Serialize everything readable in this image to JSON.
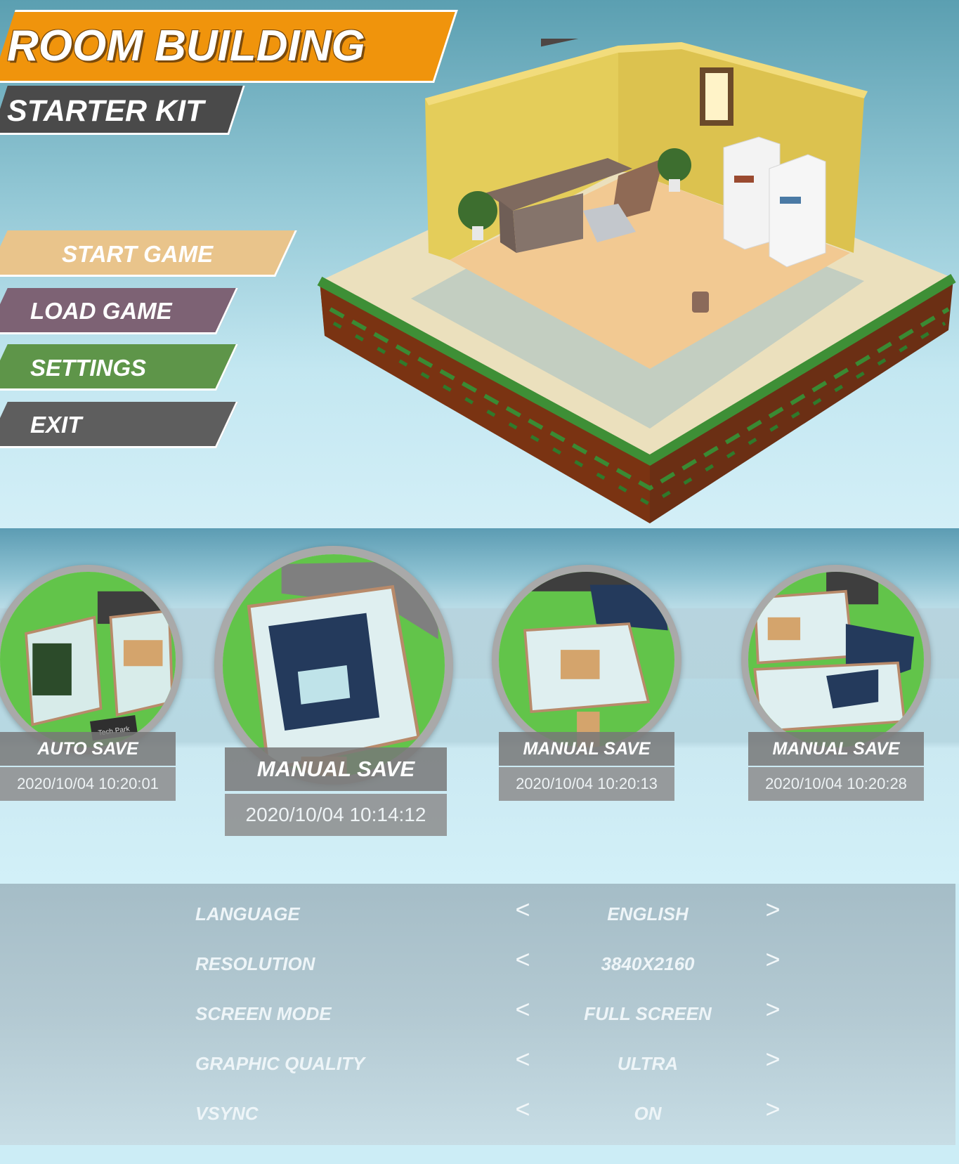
{
  "title": {
    "main": "ROOM BUILDING",
    "sub": "STARTER KIT"
  },
  "menu": [
    {
      "label": "START GAME",
      "color": "#e9c48b"
    },
    {
      "label": "LOAD GAME",
      "color": "#7d6274"
    },
    {
      "label": "SETTINGS",
      "color": "#5e9549"
    },
    {
      "label": "EXIT",
      "color": "#5e5e5e"
    }
  ],
  "saves": [
    {
      "type": "AUTO SAVE",
      "date": "2020/10/04 10:20:01",
      "sign": "Tech Park"
    },
    {
      "type": "MANUAL SAVE",
      "date": "2020/10/04 10:14:12"
    },
    {
      "type": "MANUAL SAVE",
      "date": "2020/10/04 10:20:13"
    },
    {
      "type": "MANUAL SAVE",
      "date": "2020/10/04 10:20:28"
    }
  ],
  "settings": [
    {
      "label": "LANGUAGE",
      "value": "ENGLISH"
    },
    {
      "label": "RESOLUTION",
      "value": "3840X2160"
    },
    {
      "label": "SCREEN MODE",
      "value": "FULL SCREEN"
    },
    {
      "label": "GRAPHIC QUALITY",
      "value": "ULTRA"
    },
    {
      "label": "VSYNC",
      "value": "ON"
    }
  ],
  "icons": {
    "prev": "chevron-left-icon",
    "next": "chevron-right-icon"
  },
  "glyphs": {
    "prev": "<",
    "next": ">"
  }
}
